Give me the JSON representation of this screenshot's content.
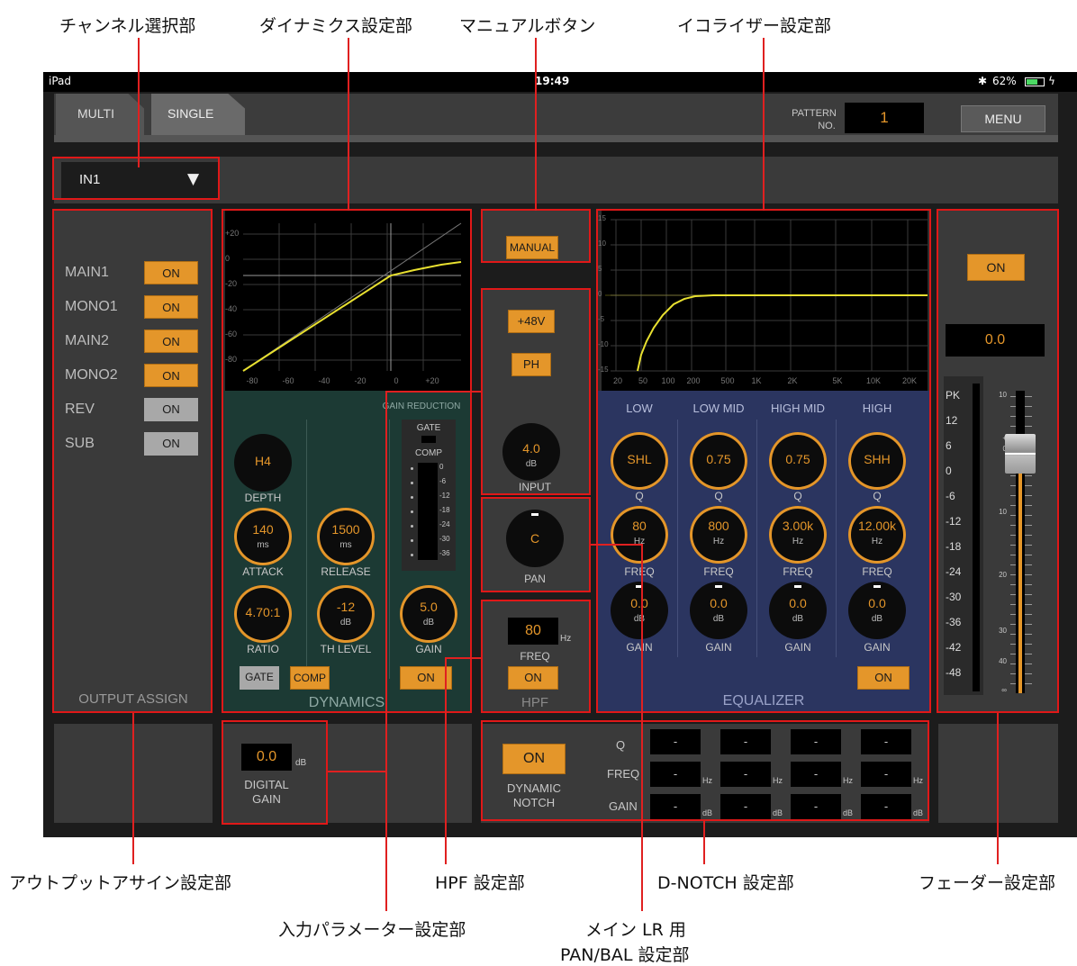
{
  "callouts": {
    "channel_select": "チャンネル選択部",
    "dynamics": "ダイナミクス設定部",
    "manual_button": "マニュアルボタン",
    "equalizer": "イコライザー設定部",
    "output_assign": "アウトプットアサイン設定部",
    "input_param": "入力パラメーター設定部",
    "hpf": "HPF 設定部",
    "pan_line1": "メイン LR 用",
    "pan_line2": "PAN/BAL 設定部",
    "dnotch": "D-NOTCH 設定部",
    "fader": "フェーダー設定部"
  },
  "status": {
    "device": "iPad",
    "time": "19:49",
    "battery": "62%"
  },
  "tabs": {
    "multi": "MULTI",
    "single": "SINGLE"
  },
  "pattern": {
    "label1": "PATTERN",
    "label2": "NO.",
    "value": "1"
  },
  "menu": "MENU",
  "channel": {
    "value": "IN1",
    "arrow": "▼"
  },
  "output_assign": {
    "title": "OUTPUT ASSIGN",
    "rows": [
      {
        "label": "MAIN1",
        "btn": "ON",
        "state": "on"
      },
      {
        "label": "MONO1",
        "btn": "ON",
        "state": "on"
      },
      {
        "label": "MAIN2",
        "btn": "ON",
        "state": "on"
      },
      {
        "label": "MONO2",
        "btn": "ON",
        "state": "on"
      },
      {
        "label": "REV",
        "btn": "ON",
        "state": "off"
      },
      {
        "label": "SUB",
        "btn": "ON",
        "state": "off"
      }
    ]
  },
  "dynamics": {
    "title": "DYNAMICS",
    "graph_y": [
      "+20",
      "0",
      "-20",
      "-40",
      "-60",
      "-80"
    ],
    "graph_x": [
      "-80",
      "-60",
      "-40",
      "-20",
      "0",
      "+20"
    ],
    "gain_reduction": "GAIN REDUCTION",
    "gate": "GATE",
    "comp": "COMP",
    "meter": [
      "0",
      "-6",
      "-12",
      "-18",
      "-24",
      "-30",
      "-36"
    ],
    "depth": {
      "value": "H4",
      "label": "DEPTH"
    },
    "attack": {
      "value": "140",
      "unit": "ms",
      "label": "ATTACK"
    },
    "release": {
      "value": "1500",
      "unit": "ms",
      "label": "RELEASE"
    },
    "ratio": {
      "value": "4.70:1",
      "label": "RATIO"
    },
    "th_level": {
      "value": "-12",
      "unit": "dB",
      "label": "TH LEVEL"
    },
    "gain": {
      "value": "5.0",
      "unit": "dB",
      "label": "GAIN"
    },
    "gate_btn": "GATE",
    "comp_btn": "COMP",
    "on_btn": "ON"
  },
  "manual": "MANUAL",
  "input": {
    "phantom": "+48V",
    "phase": "PH",
    "value": "4.0",
    "unit": "dB",
    "label": "INPUT"
  },
  "pan": {
    "value": "C",
    "label": "PAN"
  },
  "hpf": {
    "value": "80",
    "unit": "Hz",
    "label": "FREQ",
    "on": "ON",
    "title": "HPF"
  },
  "digital_gain": {
    "value": "0.0",
    "unit": "dB",
    "label1": "DIGITAL",
    "label2": "GAIN"
  },
  "equalizer": {
    "title": "EQUALIZER",
    "graph_x": [
      "20",
      "50",
      "100",
      "200",
      "500",
      "1K",
      "2K",
      "5K",
      "10K",
      "20K"
    ],
    "graph_y": [
      "15",
      "10",
      "5",
      "0",
      "-5",
      "-10",
      "-15"
    ],
    "bands": [
      {
        "name": "LOW",
        "q": "SHL",
        "freq": "80",
        "gain": "0.0"
      },
      {
        "name": "LOW MID",
        "q": "0.75",
        "freq": "800",
        "gain": "0.0"
      },
      {
        "name": "HIGH MID",
        "q": "0.75",
        "freq": "3.00k",
        "gain": "0.0"
      },
      {
        "name": "HIGH",
        "q": "SHH",
        "freq": "12.00k",
        "gain": "0.0"
      }
    ],
    "q_label": "Q",
    "freq_label": "FREQ",
    "gain_label": "GAIN",
    "hz": "Hz",
    "db": "dB",
    "on": "ON"
  },
  "dnotch": {
    "on": "ON",
    "label1": "DYNAMIC",
    "label2": "NOTCH",
    "q": "Q",
    "freq": "FREQ",
    "gain": "GAIN",
    "empty": "-",
    "hz": "Hz",
    "db": "dB"
  },
  "fader": {
    "on": "ON",
    "value": "0.0",
    "meter": [
      "PK",
      "12",
      "6",
      "0",
      "-6",
      "-12",
      "-18",
      "-24",
      "-30",
      "-36",
      "-42",
      "-48"
    ],
    "scale": [
      "10",
      "+",
      "0",
      "10",
      "20",
      "30",
      "40",
      "∞"
    ],
    "level_db": 0
  }
}
